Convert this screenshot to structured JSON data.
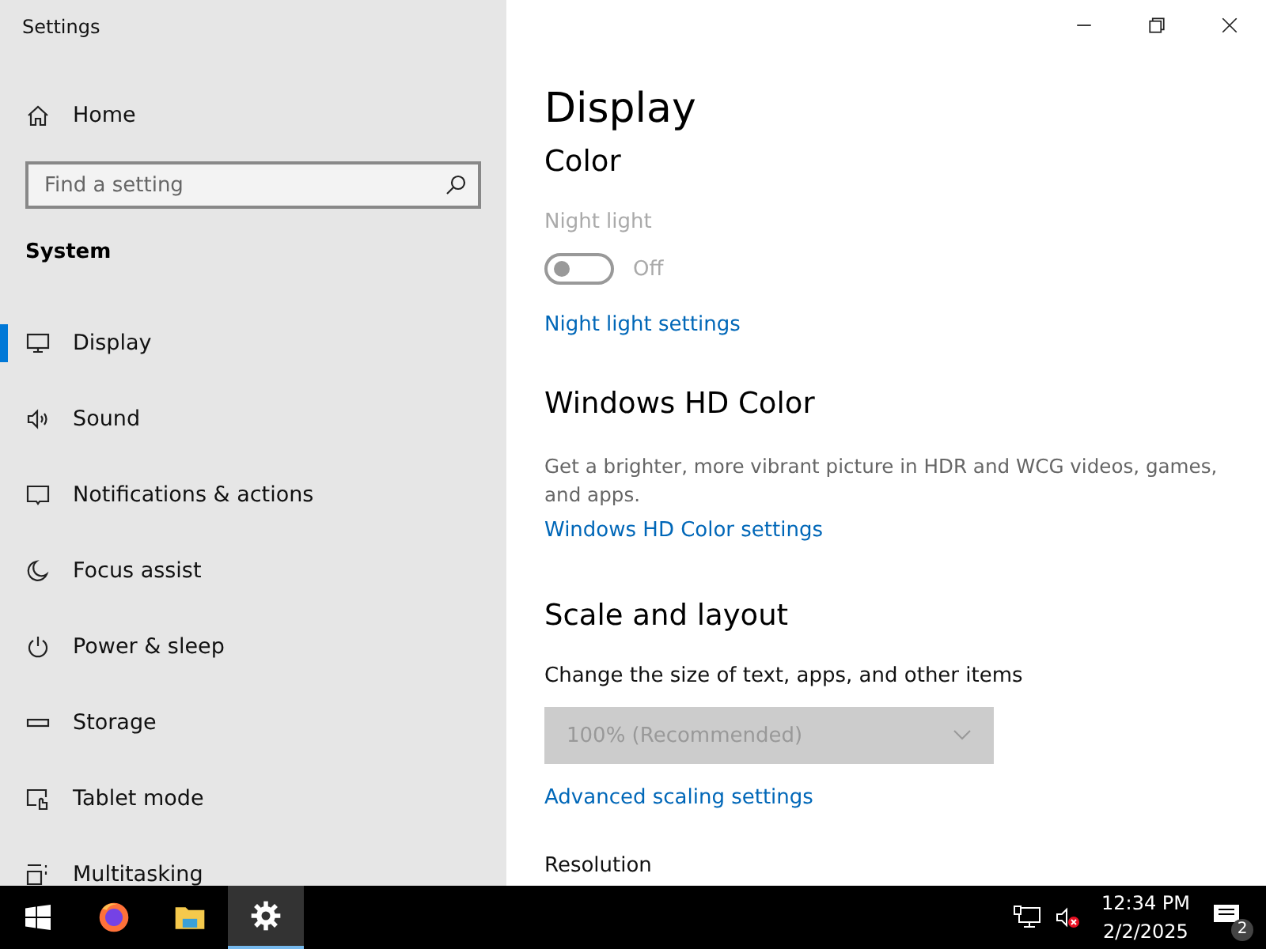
{
  "window": {
    "title": "Settings"
  },
  "sidebar": {
    "home": "Home",
    "search": {
      "placeholder": "Find a setting"
    },
    "section": "System",
    "items": [
      {
        "label": "Display",
        "selected": true
      },
      {
        "label": "Sound",
        "selected": false
      },
      {
        "label": "Notifications & actions",
        "selected": false
      },
      {
        "label": "Focus assist",
        "selected": false
      },
      {
        "label": "Power & sleep",
        "selected": false
      },
      {
        "label": "Storage",
        "selected": false
      },
      {
        "label": "Tablet mode",
        "selected": false
      },
      {
        "label": "Multitasking",
        "selected": false
      }
    ]
  },
  "page": {
    "title": "Display",
    "sections": [
      {
        "heading": "Color",
        "items": [
          {
            "kind": "label",
            "text": "Night light",
            "disabled": true
          },
          {
            "kind": "toggle",
            "on": false,
            "disabled": true,
            "state": "Off"
          },
          {
            "kind": "link",
            "text": "Night light settings"
          }
        ]
      },
      {
        "heading": "Windows HD Color",
        "items": [
          {
            "kind": "text",
            "text": "Get a brighter, more vibrant picture in HDR and WCG videos, games, and apps."
          },
          {
            "kind": "link",
            "text": "Windows HD Color settings"
          }
        ]
      },
      {
        "heading": "Scale and layout",
        "items": [
          {
            "kind": "label",
            "text": "Change the size of text, apps, and other items",
            "disabled": false
          },
          {
            "kind": "dropdown",
            "value": "100% (Recommended)",
            "disabled": true
          },
          {
            "kind": "link",
            "text": "Advanced scaling settings"
          },
          {
            "kind": "label",
            "text": "Resolution",
            "disabled": false
          }
        ]
      }
    ]
  },
  "taskbar": {
    "apps": [
      {
        "selected": false
      },
      {
        "selected": false
      },
      {
        "selected": true
      }
    ],
    "time": "12:34 PM",
    "date": "2/2/2025",
    "notification_count": "2"
  }
}
